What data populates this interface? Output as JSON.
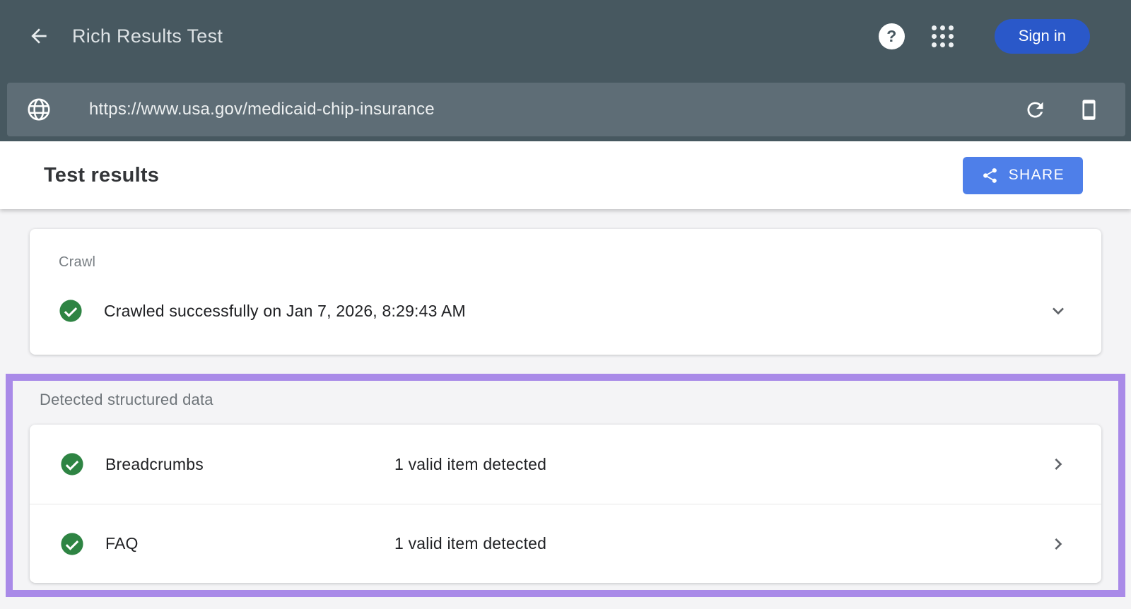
{
  "app_bar": {
    "title": "Rich Results Test",
    "sign_in_label": "Sign in"
  },
  "url_bar": {
    "url": "https://www.usa.gov/medicaid-chip-insurance"
  },
  "results_header": {
    "title": "Test results",
    "share_label": "SHARE"
  },
  "crawl_card": {
    "label": "Crawl",
    "status_text": "Crawled successfully on Jan 7, 2026, 8:29:43 AM"
  },
  "structured_data_section": {
    "label": "Detected structured data",
    "items": [
      {
        "name": "Breadcrumbs",
        "detail": "1 valid item detected"
      },
      {
        "name": "FAQ",
        "detail": "1 valid item detected"
      }
    ]
  },
  "icons": [
    "back-arrow-icon",
    "help-icon",
    "apps-grid-icon",
    "globe-icon",
    "refresh-icon",
    "smartphone-icon",
    "share-icon",
    "check-circle-icon",
    "chevron-down-icon",
    "chevron-right-icon"
  ],
  "colors": {
    "app_bar_bg": "#475860",
    "url_bar_bg": "#5e6d76",
    "sign_in_blue": "#2a58c9",
    "share_blue": "#4e7fe9",
    "success_green": "#2e8443",
    "annotation_purple": "#a98ae8",
    "page_bg": "#f4f4f6",
    "text_dark": "#202124",
    "label_gray": "#797f84"
  }
}
